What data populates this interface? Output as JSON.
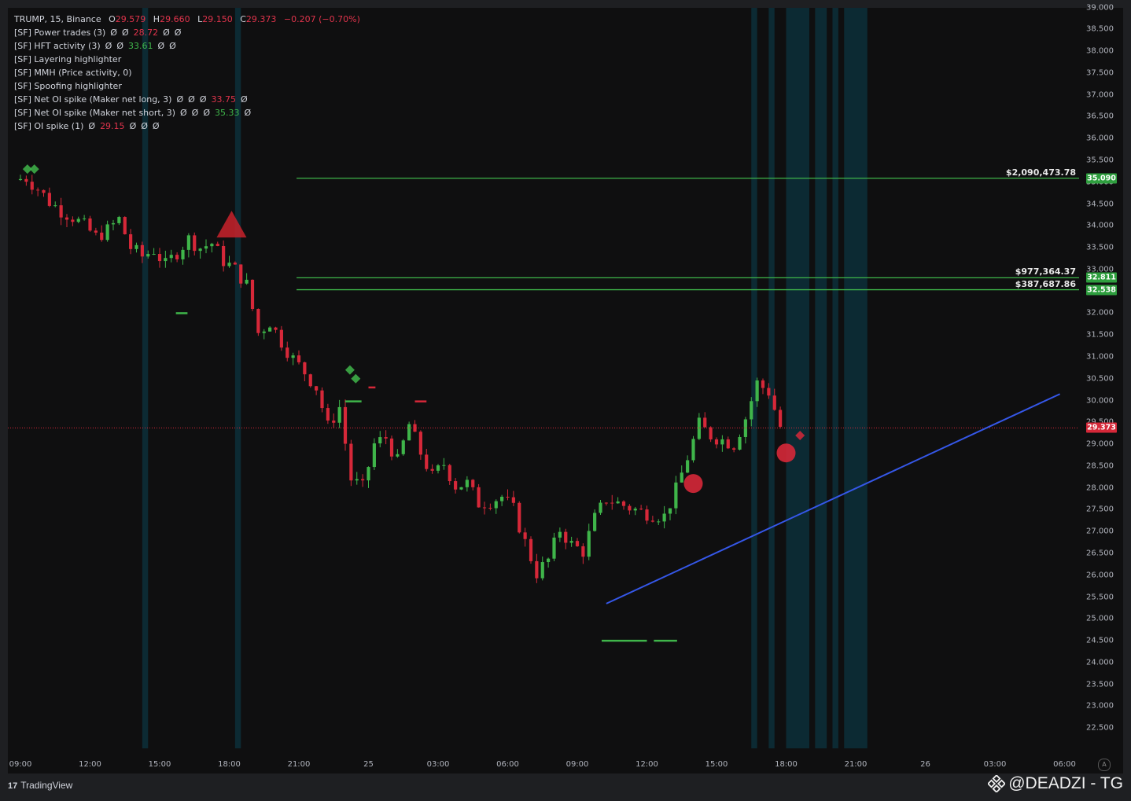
{
  "legend": {
    "symbol": {
      "name": "TRUMP, 15, Binance",
      "o_label": "O",
      "o_value": "29.579",
      "h_label": "H",
      "h_value": "29.660",
      "l_label": "L",
      "l_value": "29.150",
      "c_label": "C",
      "c_value": "29.373",
      "change": "−0.207 (−0.70%)"
    },
    "indicators": [
      {
        "name": "[SF] Power trades (3)",
        "values": [
          "Ø",
          "Ø"
        ],
        "highlight": "28.72",
        "highlight_color": "red",
        "tail": [
          "Ø",
          "Ø"
        ]
      },
      {
        "name": "[SF] HFT activity (3)",
        "values": [
          "Ø",
          "Ø"
        ],
        "highlight": "33.61",
        "highlight_color": "green",
        "tail": [
          "Ø",
          "Ø"
        ]
      },
      {
        "name": "[SF] Layering highlighter",
        "values": [],
        "highlight": "",
        "highlight_color": "",
        "tail": []
      },
      {
        "name": "[SF] MMH (Price activity, 0)",
        "values": [],
        "highlight": "",
        "highlight_color": "",
        "tail": []
      },
      {
        "name": "[SF] Spoofing highlighter",
        "values": [],
        "highlight": "",
        "highlight_color": "",
        "tail": []
      },
      {
        "name": "[SF] Net OI spike (Maker net long, 3)",
        "values": [
          "Ø",
          "Ø",
          "Ø"
        ],
        "highlight": "33.75",
        "highlight_color": "red",
        "tail": [
          "Ø"
        ]
      },
      {
        "name": "[SF] Net OI spike (Maker net short, 3)",
        "values": [
          "Ø",
          "Ø",
          "Ø"
        ],
        "highlight": "35.33",
        "highlight_color": "green",
        "tail": [
          "Ø"
        ]
      },
      {
        "name": "[SF] OI spike (1)",
        "values": [
          "Ø"
        ],
        "highlight": "29.15",
        "highlight_color": "red",
        "tail": [
          "Ø",
          "Ø",
          "Ø"
        ]
      }
    ]
  },
  "price_axis": {
    "ticks": [
      "39.000",
      "38.500",
      "38.000",
      "37.500",
      "37.000",
      "36.500",
      "36.000",
      "35.500",
      "35.000",
      "34.500",
      "34.000",
      "33.500",
      "33.000",
      "32.500",
      "32.000",
      "31.500",
      "31.000",
      "30.500",
      "30.000",
      "29.500",
      "29.000",
      "28.500",
      "28.000",
      "27.500",
      "27.000",
      "26.500",
      "26.000",
      "25.500",
      "25.000",
      "24.500",
      "24.000",
      "23.500",
      "23.000",
      "22.500"
    ],
    "min": 22.0,
    "max": 39.1
  },
  "time_axis": {
    "labels": [
      "09:00",
      "12:00",
      "15:00",
      "18:00",
      "21:00",
      "25",
      "03:00",
      "06:00",
      "09:00",
      "12:00",
      "15:00",
      "18:00",
      "21:00",
      "26",
      "03:00",
      "06:00"
    ]
  },
  "levels": [
    {
      "usd": "$2,090,473.78",
      "price": 35.09,
      "label": "35.090",
      "x_start_hour": 11.9
    },
    {
      "usd": "$977,364.37",
      "price": 32.811,
      "label": "32.811",
      "x_start_hour": 11.9
    },
    {
      "usd": "$387,687.86",
      "price": 32.538,
      "label": "32.538",
      "x_start_hour": 11.9
    }
  ],
  "current_price": {
    "value": 29.373,
    "label": "29.373"
  },
  "trendline": {
    "start": {
      "hour": 25.25,
      "price": 25.35
    },
    "end": {
      "hour": 44.8,
      "price": 30.15
    }
  },
  "highlight_zones": [
    {
      "start_hour": 5.25,
      "end_hour": 5.5
    },
    {
      "start_hour": 9.25,
      "end_hour": 9.5
    },
    {
      "start_hour": 31.5,
      "end_hour": 31.75
    },
    {
      "start_hour": 32.25,
      "end_hour": 32.5
    },
    {
      "start_hour": 33.0,
      "end_hour": 34.0
    },
    {
      "start_hour": 34.25,
      "end_hour": 34.75
    },
    {
      "start_hour": 35.0,
      "end_hour": 35.25
    },
    {
      "start_hour": 35.5,
      "end_hour": 36.5
    }
  ],
  "chart_data": {
    "type": "candlestick",
    "title": "",
    "symbol": "TRUMP, 15, Binance",
    "interval_minutes": 15,
    "x_labels": [
      "09:00",
      "12:00",
      "15:00",
      "18:00",
      "21:00",
      "25",
      "03:00",
      "06:00",
      "09:00",
      "12:00",
      "15:00",
      "18:00",
      "21:00",
      "26",
      "03:00",
      "06:00"
    ],
    "ylim": [
      22.0,
      39.1
    ],
    "ohlc_anchor_closes": [
      35.05,
      35.1,
      34.85,
      34.55,
      34.35,
      34.2,
      34.0,
      33.75,
      33.9,
      34.15,
      33.5,
      33.3,
      33.45,
      33.1,
      33.4,
      33.7,
      33.5,
      33.6,
      33.2,
      33.0,
      32.65,
      31.55,
      31.8,
      31.35,
      30.95,
      30.65,
      30.3,
      29.4,
      29.85,
      28.2,
      28.0,
      29.0,
      29.15,
      28.6,
      29.45,
      28.8,
      28.25,
      28.55,
      28.05,
      28.1,
      27.65,
      27.7,
      27.8,
      27.5,
      26.75,
      26.05,
      26.35,
      27.05,
      26.7,
      26.55,
      27.3,
      27.75,
      27.65,
      27.55,
      27.45,
      27.4,
      27.35,
      27.95,
      28.7,
      29.45,
      29.2,
      29.1,
      29.0,
      29.6,
      30.4,
      30.2,
      29.4
    ],
    "markers": [
      {
        "type": "triangle-down",
        "color": "#c8222c",
        "hour": 9.1,
        "price": 33.95
      },
      {
        "type": "circle",
        "color": "#d62839",
        "hour": 29.0,
        "price": 28.1
      },
      {
        "type": "circle",
        "color": "#d62839",
        "hour": 33.0,
        "price": 28.8
      },
      {
        "type": "diamond",
        "color": "#3fb54a",
        "hour": 0.3,
        "price": 35.3
      },
      {
        "type": "diamond",
        "color": "#3fb54a",
        "hour": 0.6,
        "price": 35.3
      },
      {
        "type": "diamond",
        "color": "#3fb54a",
        "hour": 14.2,
        "price": 30.7
      },
      {
        "type": "diamond",
        "color": "#3fb54a",
        "hour": 14.45,
        "price": 30.5
      },
      {
        "type": "diamond",
        "color": "#d62839",
        "hour": 33.6,
        "price": 29.2
      }
    ],
    "dashes": [
      {
        "color": "#3fb54a",
        "hour_start": 6.7,
        "hour_end": 7.2,
        "price": 32.0
      },
      {
        "color": "#3fb54a",
        "hour_start": 14.0,
        "hour_end": 14.7,
        "price": 29.98
      },
      {
        "color": "#d62839",
        "hour_start": 17.0,
        "hour_end": 17.5,
        "price": 29.98
      },
      {
        "color": "#d62839",
        "hour_start": 15.0,
        "hour_end": 15.3,
        "price": 30.3
      },
      {
        "color": "#3fb54a",
        "hour_start": 25.05,
        "hour_end": 27.0,
        "price": 24.5
      },
      {
        "color": "#3fb54a",
        "hour_start": 27.3,
        "hour_end": 28.3,
        "price": 24.5
      }
    ]
  },
  "colors": {
    "bull": "#3fb54a",
    "bear": "#d62839",
    "level_line": "#3fb54a",
    "level_tag": "#2e9e3e",
    "price_tag": "#d62839",
    "trendline": "#3557e8",
    "zone": "#0c2a33"
  },
  "footer": {
    "brand": "TradingView",
    "logo_text": "17",
    "watermark": "@DEADZI - TG"
  }
}
